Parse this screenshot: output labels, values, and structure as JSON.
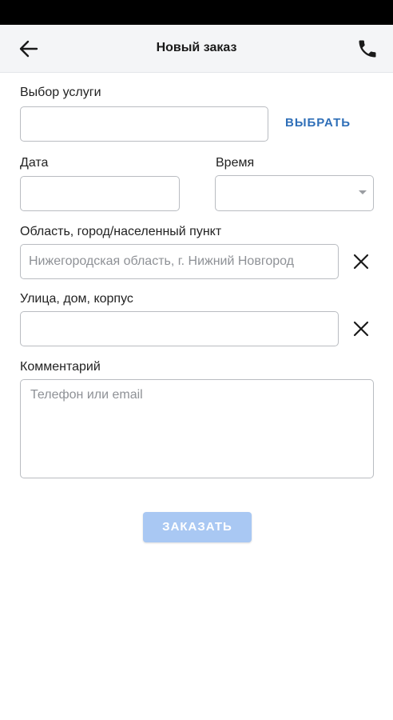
{
  "header": {
    "title": "Новый заказ",
    "back_icon": "arrow-left-icon",
    "phone_icon": "phone-icon"
  },
  "form": {
    "service": {
      "label": "Выбор услуги",
      "value": "",
      "choose_label": "ВЫБРАТЬ"
    },
    "date": {
      "label": "Дата",
      "value": ""
    },
    "time": {
      "label": "Время",
      "selected": ""
    },
    "region": {
      "label": "Область, город/населенный пункт",
      "placeholder": "Нижегородская область, г. Нижний Новгород"
    },
    "street": {
      "label": "Улица, дом, корпус",
      "value": ""
    },
    "comment": {
      "label": "Комментарий",
      "placeholder": "Телефон или email"
    },
    "submit_label": "ЗАКАЗАТЬ"
  },
  "colors": {
    "accent": "#2f6fb8",
    "submit_disabled": "#a9c8f3",
    "app_bar": "#f4f5f7"
  }
}
